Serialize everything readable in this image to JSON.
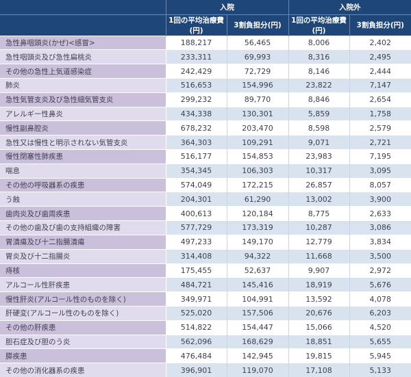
{
  "chart_data": {
    "type": "table",
    "column_groups": [
      {
        "label": "入院",
        "span": 2
      },
      {
        "label": "入院外",
        "span": 2
      }
    ],
    "sub_headers": [
      "1回の平均治療費(円)",
      "3割負担分(円)",
      "1回の平均治療費(円)",
      "3割負担分(円)"
    ],
    "rows": [
      {
        "label": "急性鼻咽頭炎(かぜ)<感冒>",
        "values": [
          "188,217",
          "56,465",
          "8,006",
          "2,402"
        ]
      },
      {
        "label": "急性咽頭炎及び急性扁桃炎",
        "values": [
          "233,311",
          "69,993",
          "8,316",
          "2,495"
        ]
      },
      {
        "label": "その他の急性上気道感染症",
        "values": [
          "242,429",
          "72,729",
          "8,146",
          "2,444"
        ]
      },
      {
        "label": "肺炎",
        "values": [
          "516,653",
          "154,996",
          "23,822",
          "7,147"
        ]
      },
      {
        "label": "急性気管支炎及び急性細気管支炎",
        "values": [
          "299,232",
          "89,770",
          "8,846",
          "2,654"
        ]
      },
      {
        "label": "アレルギー性鼻炎",
        "values": [
          "434,338",
          "130,301",
          "5,859",
          "1,758"
        ]
      },
      {
        "label": "慢性副鼻腔炎",
        "values": [
          "678,232",
          "203,470",
          "8,598",
          "2,579"
        ]
      },
      {
        "label": "急性又は慢性と明示されない気管支炎",
        "values": [
          "364,303",
          "109,291",
          "9,071",
          "2,721"
        ]
      },
      {
        "label": "慢性閉塞性肺疾患",
        "values": [
          "516,177",
          "154,853",
          "23,983",
          "7,195"
        ]
      },
      {
        "label": "喘息",
        "values": [
          "354,345",
          "106,303",
          "10,317",
          "3,095"
        ]
      },
      {
        "label": "その他の呼吸器系の疾患",
        "values": [
          "574,049",
          "172,215",
          "26,857",
          "8,057"
        ]
      },
      {
        "label": "う蝕",
        "values": [
          "204,301",
          "61,290",
          "13,002",
          "3,900"
        ]
      },
      {
        "label": "歯肉炎及び歯周疾患",
        "values": [
          "400,613",
          "120,184",
          "8,775",
          "2,633"
        ]
      },
      {
        "label": "その他の歯及び歯の支持組織の障害",
        "values": [
          "577,729",
          "173,319",
          "10,287",
          "3,086"
        ]
      },
      {
        "label": "胃潰瘍及び十二指腸潰瘍",
        "values": [
          "497,233",
          "149,170",
          "12,779",
          "3,834"
        ]
      },
      {
        "label": "胃炎及び十二指腸炎",
        "values": [
          "314,408",
          "94,322",
          "11,668",
          "3,500"
        ]
      },
      {
        "label": "痔核",
        "values": [
          "175,455",
          "52,637",
          "9,907",
          "2,972"
        ]
      },
      {
        "label": "アルコール性肝疾患",
        "values": [
          "484,721",
          "145,416",
          "18,919",
          "5,676"
        ]
      },
      {
        "label": "慢性肝炎(アルコール性のものを除く)",
        "values": [
          "349,971",
          "104,991",
          "13,592",
          "4,078"
        ]
      },
      {
        "label": "肝硬変(アルコール性のものを除く)",
        "values": [
          "525,020",
          "157,506",
          "20,676",
          "6,203"
        ]
      },
      {
        "label": "その他の肝疾患",
        "values": [
          "514,822",
          "154,447",
          "15,066",
          "4,520"
        ]
      },
      {
        "label": "胆石症及び胆のう炎",
        "values": [
          "562,096",
          "168,629",
          "18,851",
          "5,655"
        ]
      },
      {
        "label": "膵疾患",
        "values": [
          "476,484",
          "142,945",
          "19,815",
          "5,945"
        ]
      },
      {
        "label": "その他の消化器系の疾患",
        "values": [
          "396,901",
          "119,070",
          "17,108",
          "5,133"
        ]
      }
    ]
  },
  "colors": {
    "header-bg": "#1f4678",
    "header-line": "#6e86ad",
    "header-text": "#ffffff",
    "label-odd-bg": "#cbc0dc",
    "label-even-bg": "#e0dcee",
    "value-odd-bg": "#ffffff",
    "value-even-bg": "#d9e3ef",
    "grid-line": "#c9d3e1",
    "text": "#3f3d4d"
  }
}
